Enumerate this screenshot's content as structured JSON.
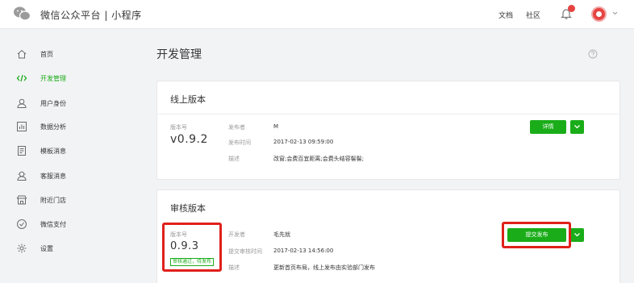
{
  "header": {
    "app_title": "微信公众平台 | 小程序",
    "docs_label": "文档",
    "community_label": "社区"
  },
  "sidebar": {
    "items": [
      {
        "label": "首页",
        "icon": "home-icon"
      },
      {
        "label": "开发管理",
        "icon": "code-icon",
        "active": true
      },
      {
        "label": "用户身份",
        "icon": "user-icon"
      },
      {
        "label": "数据分析",
        "icon": "chart-icon"
      },
      {
        "label": "模板消息",
        "icon": "template-icon"
      },
      {
        "label": "客服消息",
        "icon": "service-icon"
      },
      {
        "label": "附近门店",
        "icon": "store-icon"
      },
      {
        "label": "微信支付",
        "icon": "pay-icon"
      },
      {
        "label": "设置",
        "icon": "gear-icon"
      }
    ]
  },
  "main": {
    "title": "开发管理",
    "online": {
      "title": "线上版本",
      "version_label": "版本号",
      "version": "v0.9.2",
      "publisher_key": "发布者",
      "publisher": "M",
      "time_key": "发布时间",
      "time": "2017-02-13 09:59:00",
      "desc_key": "描述",
      "desc": "改窗;会费百宜距离;会费头结容髻髻;",
      "detail_button": "详情"
    },
    "review": {
      "title": "审核版本",
      "version_label": "版本号",
      "version": "0.9.3",
      "status": "审核通过，待发布",
      "developer_key": "开发者",
      "developer": "毛先就",
      "time_key": "提交审核时间",
      "time": "2017-02-13 14:56:00",
      "desc_key": "描述",
      "desc": "更新首页布局，线上发布由实验部门发布",
      "submit_button": "提交发布"
    }
  },
  "colors": {
    "brand_green": "#1aad19",
    "highlight_red": "#e0201b",
    "badge_red": "#e64340"
  }
}
